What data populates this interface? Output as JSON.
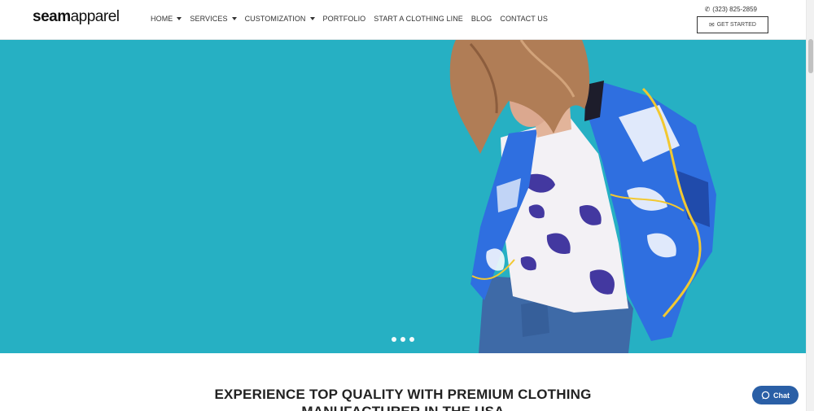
{
  "logo": {
    "bold": "seam",
    "light": "apparel"
  },
  "nav": [
    {
      "label": "HOME",
      "dropdown": true
    },
    {
      "label": "SERVICES",
      "dropdown": true
    },
    {
      "label": "CUSTOMIZATION",
      "dropdown": true
    },
    {
      "label": "PORTFOLIO",
      "dropdown": false
    },
    {
      "label": "START A CLOTHING LINE",
      "dropdown": false
    },
    {
      "label": "BLOG",
      "dropdown": false
    },
    {
      "label": "CONTACT US",
      "dropdown": false
    }
  ],
  "header": {
    "phone": "(323) 825-2859",
    "cta_label": "GET STARTED"
  },
  "hero": {
    "background": "#26b0c3",
    "slide_count": 3,
    "active_slide": 1
  },
  "content": {
    "headline_line1": "EXPERIENCE TOP QUALITY WITH PREMIUM CLOTHING",
    "headline_line2": "MANUFACTURER IN THE USA"
  },
  "chat": {
    "label": "Chat"
  },
  "icons": {
    "phone": "phone-icon",
    "envelope": "envelope-icon",
    "chat": "chat-bubble-icon"
  }
}
